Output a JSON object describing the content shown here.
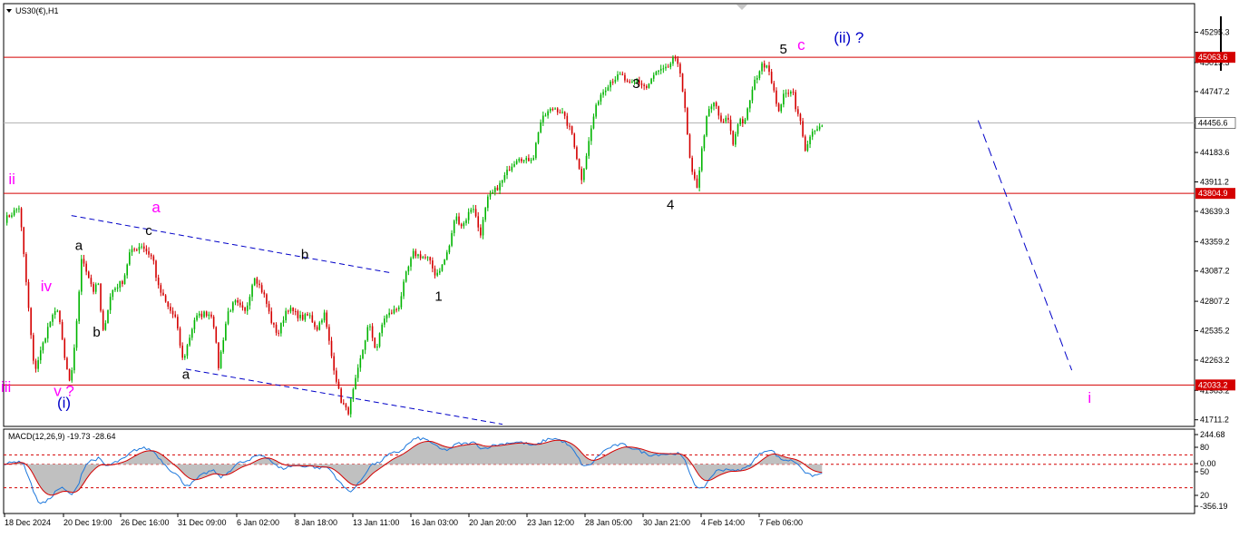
{
  "header": {
    "symbol_label": "US30(€),H1",
    "macd_label": "MACD(12,26,9) -19.73 -28.64"
  },
  "colors": {
    "bull_candle": "#00b400",
    "bear_candle": "#d40000",
    "level_line": "#d40000",
    "current_price_line": "#b4b4b4",
    "trend_line": "#0000c8",
    "macd_hist": "#c0c0c0",
    "macd_line": "#1e78dc",
    "signal_line": "#d40000",
    "label_magenta": "#ff00ff",
    "label_black": "#000000",
    "label_blue": "#0000c8"
  },
  "chart_data": {
    "type": "candlestick",
    "symbol": "US30(€)",
    "timeframe": "H1",
    "y_axis_ticks": [
      45295.3,
      45015.3,
      44747.2,
      44183.6,
      43911.2,
      43639.3,
      43359.2,
      43087.2,
      42807.2,
      42535.2,
      42263.2,
      41983.2,
      41711.2
    ],
    "y_range": [
      41650,
      45560
    ],
    "x_axis_ticks": [
      "18 Dec 2024",
      "20 Dec 19:00",
      "26 Dec 16:00",
      "31 Dec 09:00",
      "6 Jan 02:00",
      "8 Jan 18:00",
      "13 Jan 11:00",
      "16 Jan 03:00",
      "20 Jan 20:00",
      "23 Jan 12:00",
      "28 Jan 05:00",
      "30 Jan 21:00",
      "4 Feb 14:00",
      "7 Feb 06:00"
    ],
    "levels": [
      {
        "value": 45063.6,
        "label": "45063.6"
      },
      {
        "value": 43804.9,
        "label": "43804.9"
      },
      {
        "value": 42033.2,
        "label": "42033.2"
      }
    ],
    "current_price": {
      "value": 44456.6,
      "label": "44456.6"
    },
    "price_path": [
      [
        0,
        43560
      ],
      [
        1,
        43680
      ],
      [
        2,
        42150
      ],
      [
        3,
        42600
      ],
      [
        3.6,
        42750
      ],
      [
        4,
        42300
      ],
      [
        4.4,
        42050
      ],
      [
        4.6,
        42200
      ],
      [
        5.2,
        43220
      ],
      [
        6,
        42900
      ],
      [
        6.3,
        42980
      ],
      [
        6.6,
        42500
      ],
      [
        7.2,
        42900
      ],
      [
        8,
        43000
      ],
      [
        8.4,
        43250
      ],
      [
        9.2,
        43330
      ],
      [
        10,
        43200
      ],
      [
        10.3,
        42950
      ],
      [
        11,
        42750
      ],
      [
        11.5,
        42650
      ],
      [
        12,
        42250
      ],
      [
        12.8,
        42650
      ],
      [
        13.5,
        42700
      ],
      [
        14,
        42680
      ],
      [
        14.4,
        42200
      ],
      [
        15,
        42700
      ],
      [
        15.5,
        42800
      ],
      [
        16.2,
        42700
      ],
      [
        16.8,
        43050
      ],
      [
        17.5,
        42850
      ],
      [
        18,
        42600
      ],
      [
        18.4,
        42500
      ],
      [
        19,
        42750
      ],
      [
        20,
        42650
      ],
      [
        20.5,
        42680
      ],
      [
        21,
        42550
      ],
      [
        21.5,
        42700
      ],
      [
        22,
        42300
      ],
      [
        22.6,
        41900
      ],
      [
        23.1,
        41770
      ],
      [
        23.5,
        42000
      ],
      [
        24,
        42300
      ],
      [
        24.5,
        42600
      ],
      [
        25,
        42350
      ],
      [
        25.5,
        42650
      ],
      [
        26.5,
        42750
      ],
      [
        27,
        43050
      ],
      [
        27.5,
        43250
      ],
      [
        28.5,
        43200
      ],
      [
        29,
        43050
      ],
      [
        29.5,
        43150
      ],
      [
        30,
        43350
      ],
      [
        30.3,
        43600
      ],
      [
        30.8,
        43500
      ],
      [
        31.5,
        43700
      ],
      [
        32,
        43420
      ],
      [
        32.5,
        43750
      ],
      [
        33.4,
        43900
      ],
      [
        34,
        44050
      ],
      [
        34.6,
        44150
      ],
      [
        35,
        44100
      ],
      [
        35.6,
        44150
      ],
      [
        36,
        44450
      ],
      [
        36.5,
        44550
      ],
      [
        37,
        44600
      ],
      [
        37.5,
        44550
      ],
      [
        38.2,
        44350
      ],
      [
        38.8,
        43930
      ],
      [
        39.2,
        44200
      ],
      [
        39.6,
        44500
      ],
      [
        40,
        44700
      ],
      [
        40.8,
        44850
      ],
      [
        41.5,
        44900
      ],
      [
        42,
        44800
      ],
      [
        42.5,
        44850
      ],
      [
        43.2,
        44780
      ],
      [
        43.8,
        44920
      ],
      [
        44.5,
        44950
      ],
      [
        45,
        45040
      ],
      [
        45.4,
        45000
      ],
      [
        45.8,
        44550
      ],
      [
        46,
        44250
      ],
      [
        46.2,
        44000
      ],
      [
        46.6,
        43870
      ],
      [
        47,
        44300
      ],
      [
        47.3,
        44550
      ],
      [
        47.8,
        44650
      ],
      [
        48.2,
        44450
      ],
      [
        48.7,
        44500
      ],
      [
        49,
        44250
      ],
      [
        49.4,
        44500
      ],
      [
        49.8,
        44450
      ],
      [
        50.1,
        44650
      ],
      [
        50.5,
        44850
      ],
      [
        50.9,
        44980
      ],
      [
        51.3,
        45010
      ],
      [
        51.7,
        44800
      ],
      [
        52,
        44550
      ],
      [
        52.4,
        44700
      ],
      [
        53,
        44780
      ],
      [
        53.3,
        44550
      ],
      [
        53.6,
        44450
      ],
      [
        53.8,
        44200
      ],
      [
        54.2,
        44320
      ],
      [
        54.5,
        44380
      ],
      [
        55,
        44420
      ]
    ],
    "macd_axis_ticks": [
      "244.68",
      "80",
      "0.00",
      "50",
      "20",
      "-356.19"
    ],
    "macd_range": [
      -420,
      300
    ],
    "macd_levels": [
      80,
      0,
      -200
    ],
    "macd_params": {
      "fast": 12,
      "slow": 26,
      "signal": 9
    },
    "macd_values": {
      "main": -19.73,
      "signal": -28.64
    }
  },
  "annotations": {
    "wave_labels": [
      {
        "text": "ii",
        "color": "magenta",
        "i": 0.5,
        "price": 43890
      },
      {
        "text": "iv",
        "color": "magenta",
        "i": 2.8,
        "price": 42900
      },
      {
        "text": "iii",
        "color": "magenta",
        "i": 0.1,
        "price": 41970
      },
      {
        "text": "v ?",
        "color": "magenta",
        "i": 4.0,
        "price": 41930
      },
      {
        "text": "(i)",
        "color": "blue",
        "i": 4.0,
        "price": 41820
      },
      {
        "text": "a",
        "color": "black",
        "i": 5.0,
        "price": 43280
      },
      {
        "text": "b",
        "color": "black",
        "i": 6.2,
        "price": 42480
      },
      {
        "text": "c",
        "color": "black",
        "i": 9.7,
        "price": 43420
      },
      {
        "text": "a",
        "color": "magenta",
        "i": 10.2,
        "price": 43630
      },
      {
        "text": "a",
        "color": "black",
        "i": 12.2,
        "price": 42090
      },
      {
        "text": "b",
        "color": "black",
        "i": 20.2,
        "price": 43200
      },
      {
        "text": "1",
        "color": "black",
        "i": 29.2,
        "price": 42810
      },
      {
        "text": "3",
        "color": "black",
        "i": 42.5,
        "price": 44780
      },
      {
        "text": "4",
        "color": "black",
        "i": 44.8,
        "price": 43660
      },
      {
        "text": "5",
        "color": "black",
        "i": 52.4,
        "price": 45100
      },
      {
        "text": "c",
        "color": "magenta",
        "i": 53.6,
        "price": 45130
      },
      {
        "text": "(ii) ?",
        "color": "blue",
        "i": 56.8,
        "price": 45200
      },
      {
        "text": "i",
        "color": "magenta",
        "i": 73.0,
        "price": 41870
      }
    ],
    "trend_lines": [
      {
        "from": [
          4.5,
          43600
        ],
        "to": [
          26,
          43070
        ]
      },
      {
        "from": [
          12.2,
          42180
        ],
        "to": [
          33.5,
          41670
        ]
      }
    ],
    "projection": {
      "from": [
        65.5,
        44480
      ],
      "to": [
        71.8,
        42170
      ]
    }
  }
}
